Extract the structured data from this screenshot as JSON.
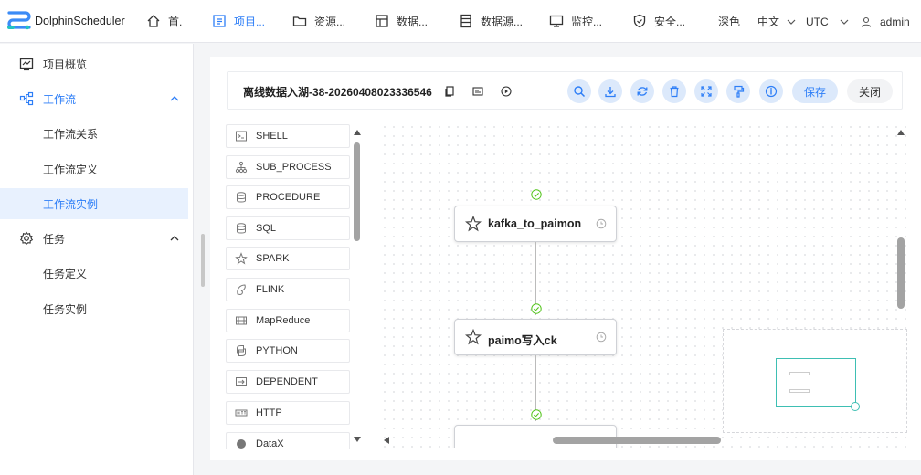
{
  "brand": {
    "name": "DolphinScheduler"
  },
  "nav": [
    {
      "label": "首.",
      "icon": "home-icon"
    },
    {
      "label": "项目...",
      "icon": "project-icon",
      "active": true
    },
    {
      "label": "资源...",
      "icon": "folder-icon"
    },
    {
      "label": "数据...",
      "icon": "data-icon"
    },
    {
      "label": "数据源...",
      "icon": "datasource-icon"
    },
    {
      "label": "监控...",
      "icon": "monitor-icon"
    },
    {
      "label": "安全...",
      "icon": "shield-icon"
    }
  ],
  "header_right": {
    "theme": "深色",
    "language": "中文",
    "timezone": "UTC",
    "user": "admin"
  },
  "sidebar": {
    "items": [
      {
        "label": "项目概览"
      },
      {
        "label": "工作流"
      },
      {
        "label": "工作流关系"
      },
      {
        "label": "工作流定义"
      },
      {
        "label": "工作流实例"
      },
      {
        "label": "任务"
      },
      {
        "label": "任务定义"
      },
      {
        "label": "任务实例"
      }
    ]
  },
  "toolbar": {
    "workflow_title": "离线数据入湖-38-20260408023336546",
    "save_label": "保存",
    "close_label": "关闭"
  },
  "palette": {
    "items": [
      "SHELL",
      "SUB_PROCESS",
      "PROCEDURE",
      "SQL",
      "SPARK",
      "FLINK",
      "MapReduce",
      "PYTHON",
      "DEPENDENT",
      "HTTP",
      "DataX"
    ]
  },
  "canvas": {
    "nodes": [
      {
        "label": "kafka_to_paimon"
      },
      {
        "label": "paimo写入ck"
      }
    ]
  },
  "colors": {
    "accent": "#2d7ef7",
    "success": "#52c41a",
    "minimap": "#3ebfb3"
  }
}
